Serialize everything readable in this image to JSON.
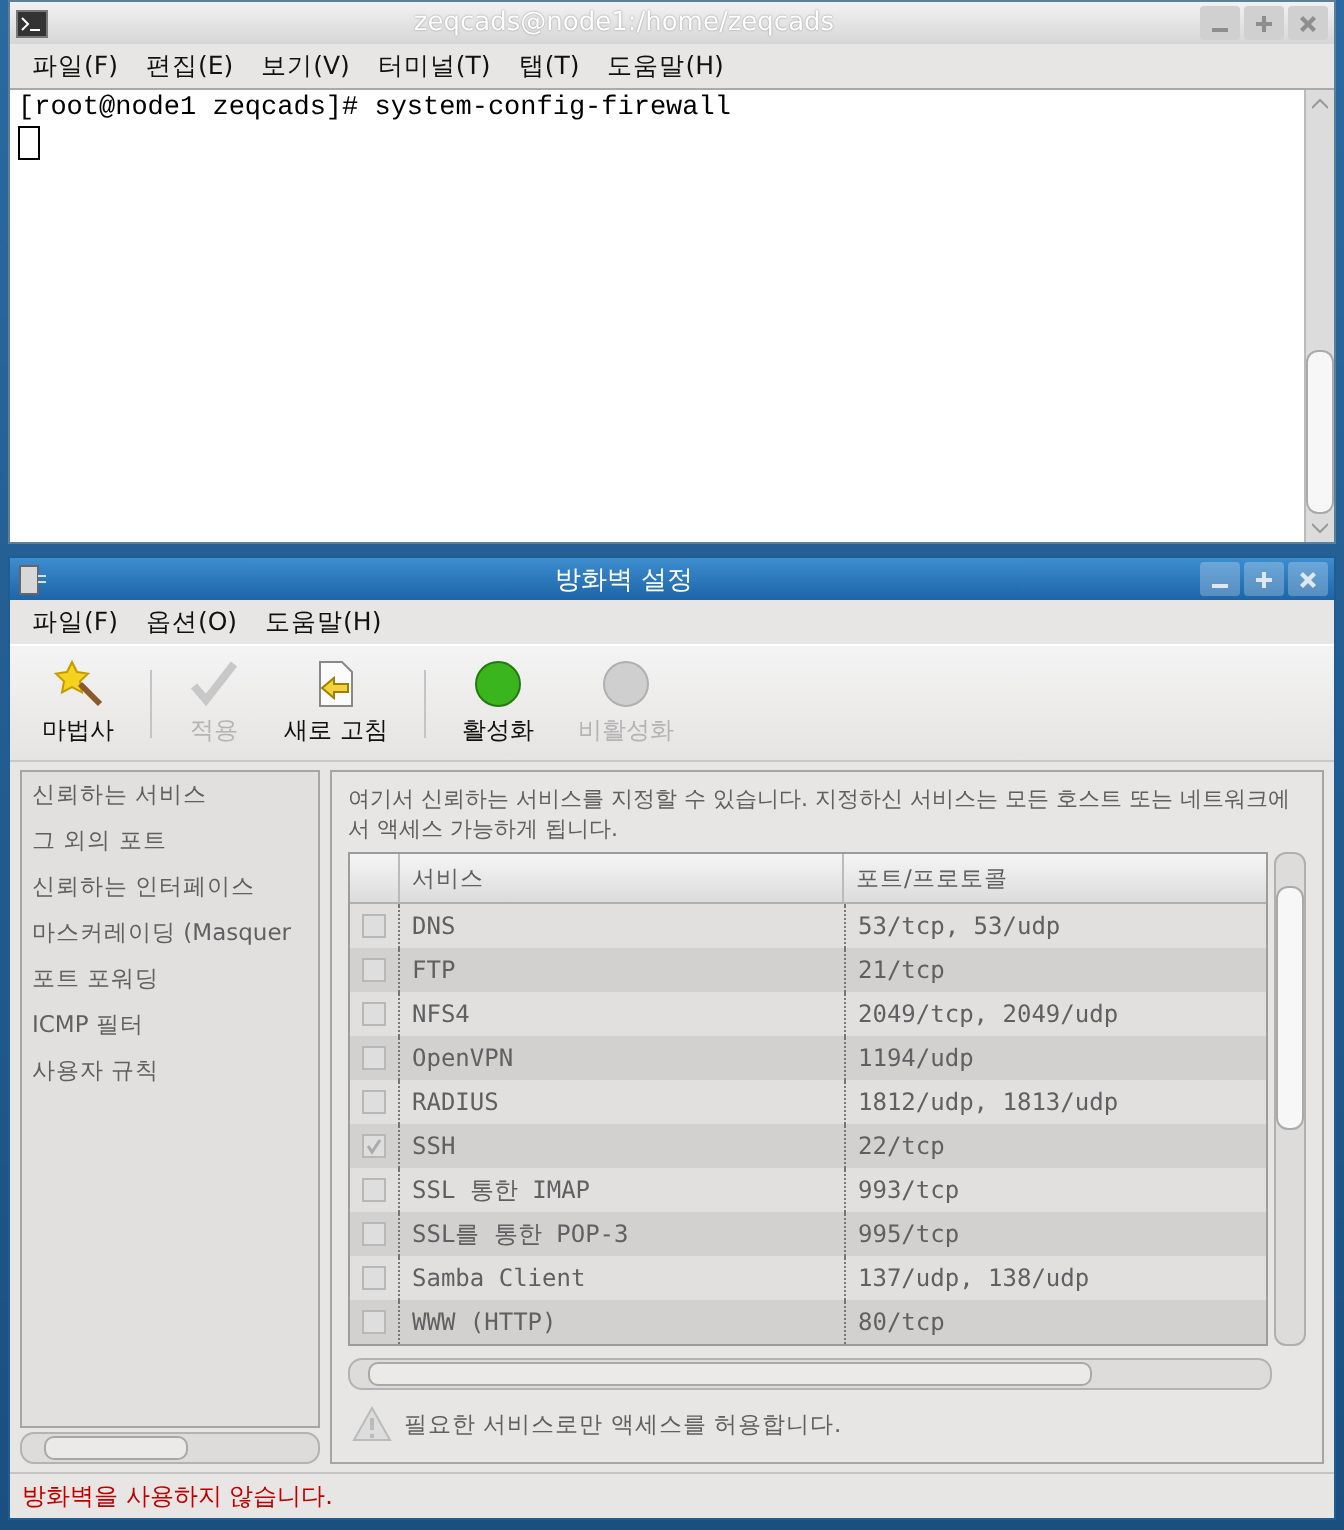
{
  "terminal": {
    "title": "zeqcads@node1:/home/zeqcads",
    "menu": [
      "파일(F)",
      "편집(E)",
      "보기(V)",
      "터미널(T)",
      "탭(T)",
      "도움말(H)"
    ],
    "lines": [
      "[root@node1 zeqcads]# system-config-firewall"
    ]
  },
  "firewall": {
    "title": "방화벽 설정",
    "menu": [
      "파일(F)",
      "옵션(O)",
      "도움말(H)"
    ],
    "toolbar": [
      {
        "kind": "wizard",
        "label": "마법사",
        "disabled": false
      },
      {
        "kind": "apply",
        "label": "적용",
        "disabled": true
      },
      {
        "kind": "refresh",
        "label": "새로 고침",
        "disabled": false
      },
      {
        "kind": "enable",
        "label": "활성화",
        "disabled": false
      },
      {
        "kind": "disable",
        "label": "비활성화",
        "disabled": true
      }
    ],
    "content_disabled": true,
    "sidebar": {
      "items": [
        "신뢰하는 서비스",
        "그 외의 포트",
        "신뢰하는 인터페이스",
        "마스커레이딩 (Masquer",
        "포트 포워딩",
        "ICMP 필터",
        "사용자 규칙"
      ]
    },
    "description": "여기서 신뢰하는 서비스를 지정할 수 있습니다. 지정하신 서비스는 모든 호스트 또는 네트워크에서 액세스 가능하게 됩니다.",
    "table": {
      "columns": [
        "서비스",
        "포트/프로토콜"
      ],
      "rows": [
        {
          "service": "DNS",
          "ports": "53/tcp, 53/udp",
          "checked": false
        },
        {
          "service": "FTP",
          "ports": "21/tcp",
          "checked": false
        },
        {
          "service": "NFS4",
          "ports": "2049/tcp, 2049/udp",
          "checked": false
        },
        {
          "service": "OpenVPN",
          "ports": "1194/udp",
          "checked": false
        },
        {
          "service": "RADIUS",
          "ports": "1812/udp, 1813/udp",
          "checked": false
        },
        {
          "service": "SSH",
          "ports": "22/tcp",
          "checked": true
        },
        {
          "service": "SSL 통한 IMAP",
          "ports": "993/tcp",
          "checked": false
        },
        {
          "service": "SSL를 통한 POP-3",
          "ports": "995/tcp",
          "checked": false
        },
        {
          "service": "Samba Client",
          "ports": "137/udp, 138/udp",
          "checked": false
        },
        {
          "service": "WWW (HTTP)",
          "ports": "80/tcp",
          "checked": false
        }
      ]
    },
    "warning": "필요한 서비스로만 액세스를 허용합니다.",
    "status": "방화벽을 사용하지 않습니다."
  }
}
